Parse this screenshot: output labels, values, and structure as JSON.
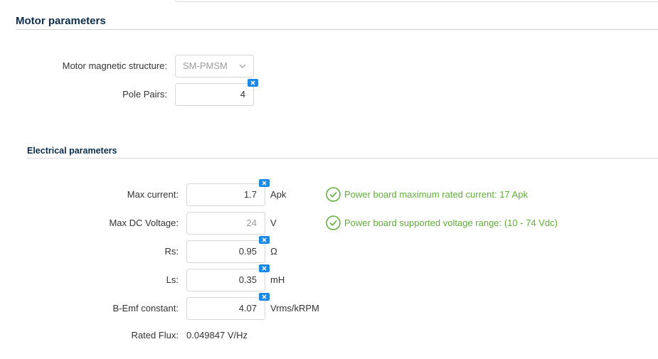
{
  "motor_section": {
    "title": "Motor parameters",
    "magnetic_structure": {
      "label": "Motor magnetic structure:",
      "value": "SM-PMSM"
    },
    "pole_pairs": {
      "label": "Pole Pairs:",
      "value": "4"
    }
  },
  "electrical_section": {
    "title": "Electrical parameters",
    "max_current": {
      "label": "Max current:",
      "value": "1.7",
      "unit": "Apk",
      "status": "Power board maximum rated current: 17 Apk"
    },
    "max_dc_voltage": {
      "label": "Max DC Voltage:",
      "value": "24",
      "unit": "V",
      "status": "Power board supported voltage range: (10 - 74 Vdc)"
    },
    "rs": {
      "label": "Rs:",
      "value": "0.95",
      "unit": "Ω"
    },
    "ls": {
      "label": "Ls:",
      "value": "0.35",
      "unit": "mH"
    },
    "bemf": {
      "label": "B-Emf constant:",
      "value": "4.07",
      "unit": "Vrms/kRPM"
    },
    "rated_flux": {
      "label": "Rated Flux:",
      "value": "0.049847 V/Hz"
    }
  },
  "colors": {
    "heading": "#0c2e4e",
    "success": "#5fae37",
    "clear_button": "#1e88e5"
  },
  "icons": {
    "clear": "clear-x-icon",
    "ok": "check-circle-icon",
    "dropdown": "chevron-down-icon"
  }
}
